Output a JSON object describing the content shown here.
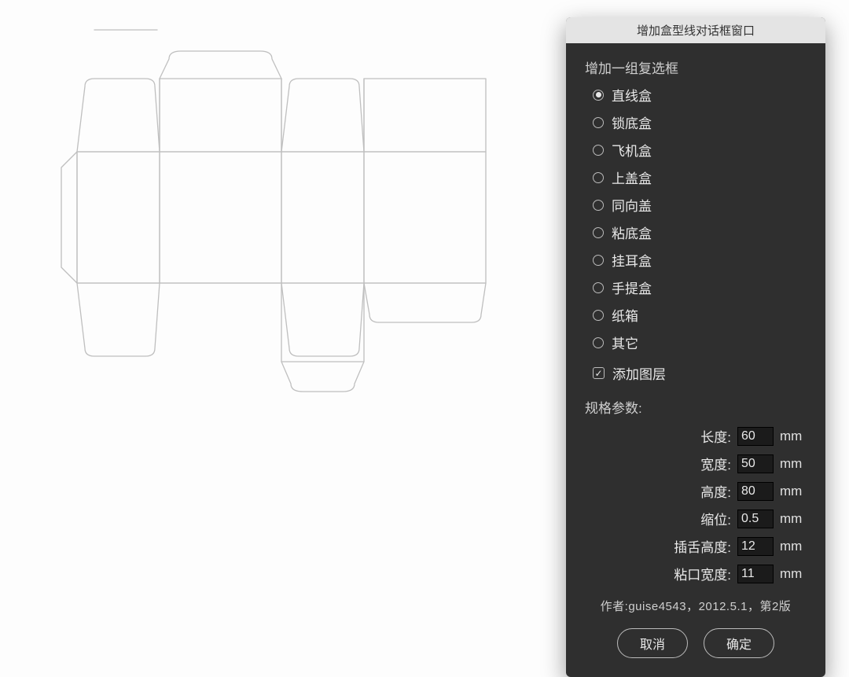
{
  "dialog": {
    "title": "增加盒型线对话框窗口",
    "radio_section_title": "增加一组复选框",
    "radios": [
      {
        "label": "直线盒",
        "selected": true
      },
      {
        "label": "锁底盒",
        "selected": false
      },
      {
        "label": "飞机盒",
        "selected": false
      },
      {
        "label": "上盖盒",
        "selected": false
      },
      {
        "label": "同向盖",
        "selected": false
      },
      {
        "label": "粘底盒",
        "selected": false
      },
      {
        "label": "挂耳盒",
        "selected": false
      },
      {
        "label": "手提盒",
        "selected": false
      },
      {
        "label": "纸箱",
        "selected": false
      },
      {
        "label": "其它",
        "selected": false
      }
    ],
    "checkbox": {
      "label": "添加图层",
      "checked": true
    },
    "params_title": "规格参数:",
    "params": [
      {
        "label": "长度:",
        "value": "60",
        "unit": "mm"
      },
      {
        "label": "宽度:",
        "value": "50",
        "unit": "mm"
      },
      {
        "label": "高度:",
        "value": "80",
        "unit": "mm"
      },
      {
        "label": "缩位:",
        "value": "0.5",
        "unit": "mm"
      },
      {
        "label": "插舌高度:",
        "value": "12",
        "unit": "mm"
      },
      {
        "label": "粘口宽度:",
        "value": "11",
        "unit": "mm"
      }
    ],
    "author_line": "作者:guise4543，2012.5.1，第2版",
    "cancel_label": "取消",
    "ok_label": "确定"
  }
}
